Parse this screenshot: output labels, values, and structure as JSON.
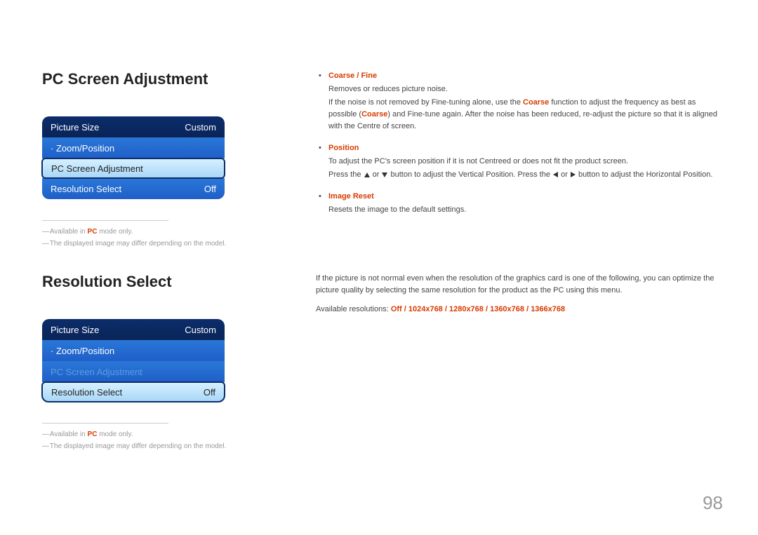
{
  "page_number": "98",
  "section1": {
    "title": "PC Screen Adjustment",
    "menu": [
      {
        "label": "Picture Size",
        "value": "Custom",
        "style": "dark"
      },
      {
        "label": "Zoom/Position",
        "value": "",
        "style": "light",
        "dot": true
      },
      {
        "label": "PC Screen Adjustment",
        "value": "",
        "style": "selected"
      },
      {
        "label": "Resolution Select",
        "value": "Off",
        "style": "light"
      }
    ],
    "footnotes": [
      {
        "pre": "Available in ",
        "accent": "PC",
        "post": " mode only."
      },
      {
        "text": "The displayed image may differ depending on the model."
      }
    ],
    "bullets": [
      {
        "title": "Coarse / Fine",
        "paras": [
          "Removes or reduces picture noise.",
          "__coarse_fine_detail__"
        ]
      },
      {
        "title": "Position",
        "paras": [
          "To adjust the PC's screen position if it is not Centreed or does not fit the product screen.",
          "__position_detail__"
        ]
      },
      {
        "title": "Image Reset",
        "paras": [
          "Resets the image to the default settings."
        ]
      }
    ],
    "coarse_fine_pre": "If the noise is not removed by Fine-tuning alone, use the ",
    "coarse_fine_word": "Coarse",
    "coarse_fine_mid": " function to adjust the frequency as best as possible (",
    "coarse_fine_word2": "Coarse",
    "coarse_fine_post": ") and Fine-tune again. After the noise has been reduced, re-adjust the picture so that it is aligned with the Centre of screen.",
    "position_pre": "Press the ",
    "position_mid1": " or ",
    "position_mid2": " button to adjust the Vertical Position. Press the ",
    "position_mid3": " or ",
    "position_post": " button to adjust the Horizontal Position."
  },
  "section2": {
    "title": "Resolution Select",
    "menu": [
      {
        "label": "Picture Size",
        "value": "Custom",
        "style": "dark"
      },
      {
        "label": "Zoom/Position",
        "value": "",
        "style": "light",
        "dot": true
      },
      {
        "label": "PC Screen Adjustment",
        "value": "",
        "style": "light",
        "dim": true
      },
      {
        "label": "Resolution Select",
        "value": "Off",
        "style": "selected"
      }
    ],
    "footnotes": [
      {
        "pre": "Available in ",
        "accent": "PC",
        "post": " mode only."
      },
      {
        "text": "The displayed image may differ depending on the model."
      }
    ],
    "intro": "If the picture is not normal even when the resolution of the graphics card is one of the following, you can optimize the picture quality by selecting the same resolution for the product as the PC using this menu.",
    "res_label": "Available resolutions: ",
    "resolutions": [
      "Off",
      "1024x768",
      "1280x768",
      "1360x768",
      "1366x768"
    ],
    "sep": " / "
  }
}
